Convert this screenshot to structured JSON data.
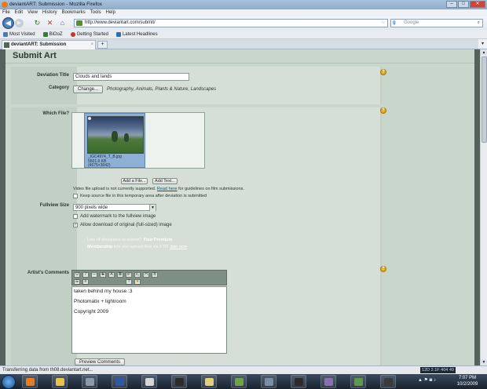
{
  "window": {
    "title": "deviantART: Submission - Mozilla Firefox",
    "min": "–",
    "max": "□",
    "close": "✕"
  },
  "menu": [
    "File",
    "Edit",
    "View",
    "History",
    "Bookmarks",
    "Tools",
    "Help"
  ],
  "nav": {
    "back": "◀",
    "forward": "▶",
    "reload": "↻",
    "stop": "✕",
    "home": "⌂",
    "url": "http://www.deviantart.com/submit/",
    "search_placeholder": "Google",
    "search_engine": "g",
    "search_go": "⌕"
  },
  "bookmarks": [
    {
      "label": "Most Visited",
      "color": "#4d79b8"
    },
    {
      "label": "BiOoZ",
      "color": "#3a7a3a"
    },
    {
      "label": "Getting Started",
      "color": "#c0392b"
    },
    {
      "label": "Latest Headlines",
      "color": "#2e6fb0"
    }
  ],
  "tab": {
    "label": "deviantART: Submission",
    "close": "×",
    "new": "+"
  },
  "page": {
    "title": "Submit Art",
    "help": "?",
    "deviation_title_label": "Deviation Title",
    "deviation_title_value": "Clouds and lands",
    "category_label": "Category",
    "change_button": "Change...",
    "category_path": "Photography, Animals, Plants & Nature, Landscapes",
    "which_file_label": "Which File?",
    "file": {
      "name": "_IGC4974_T_B.jpg",
      "size": "5501.6 KB",
      "dims": "(4675×3042)"
    },
    "add_file_button": "Add a File...",
    "add_text_button": "Add Text...",
    "video_note_a": "Video file upload is not currently supported.",
    "video_note_link": "Read here",
    "video_note_b": "for guidelines on film submissions.",
    "keep_source": "Keep source file in this temporary area after deviation is submitted",
    "fullview_label": "Fullview Size",
    "fullview_value": "900 pixels wide",
    "watermark": "Add watermark to the fullview image",
    "allow_download": "Allow download of original (full-sized) image",
    "allow_download_checked": "✓",
    "promo1_a": "Lots of deviations to submit?",
    "promo1_b": "Your Premium",
    "promo2_a": "Membership",
    "promo2_b": "lets you upload files via FTP.",
    "promo2_link": "Join now",
    "comments_label": "Artist's Comments",
    "editor_lines": [
      "taken behind my house :3",
      "Photomatix + lightroom",
      "Copyright 2009"
    ],
    "preview_button": "Preview Comments",
    "toolbar_row1": [
      "U",
      "I",
      "—",
      "S",
      "A",
      "B",
      "x²",
      "x₂",
      "H",
      "B"
    ],
    "toolbar_row2": [
      "☰",
      "≡",
      "?",
      "★"
    ]
  },
  "status": {
    "text": "Transferring data from th08.deviantart.net...",
    "lr": "12D 2.1F 404 49"
  },
  "taskbar": {
    "tray": "▲ ⚑ ◙ ♪",
    "time": "7:07 PM",
    "date": "10/2/2009",
    "apps": [
      "#e67c1f",
      "#e8c24a",
      "#8a9aaa",
      "#2a5aa8",
      "#d6d6d6",
      "#2c2c2c",
      "#e5d07a",
      "#6ba544",
      "#7a8ea8",
      "#2c2c2c",
      "#8a6fb0",
      "#5a9a4a",
      "#3a3a3a"
    ]
  }
}
